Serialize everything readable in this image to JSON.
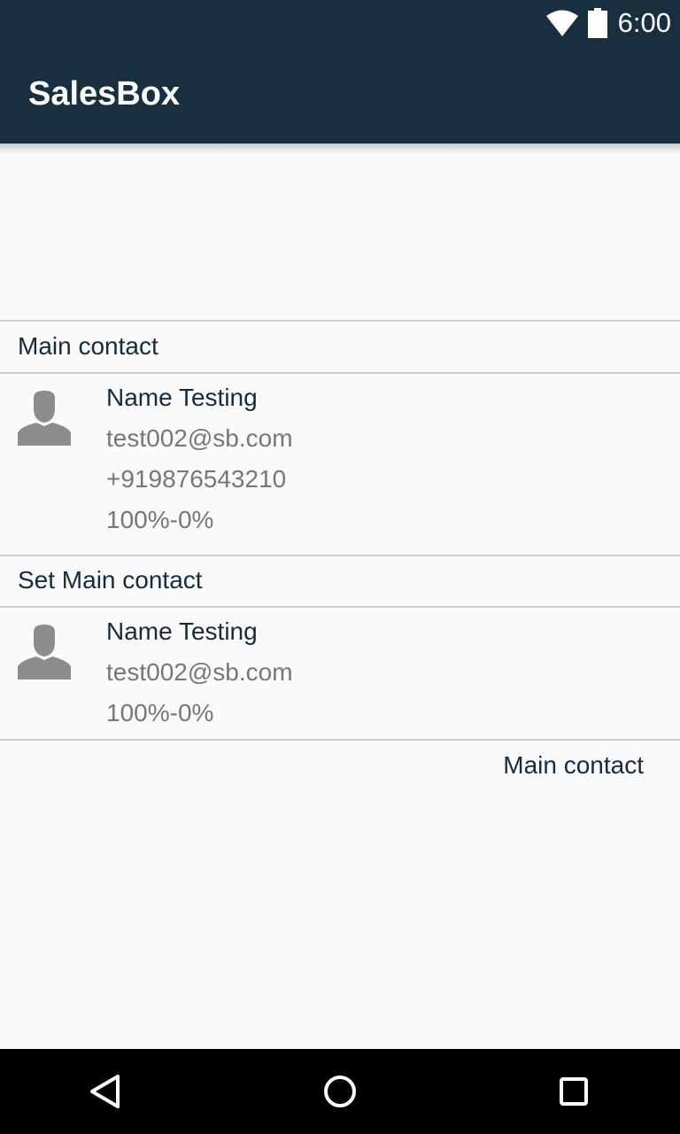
{
  "status_bar": {
    "time": "6:00",
    "icons": [
      "wifi-icon",
      "battery-icon"
    ]
  },
  "app_bar": {
    "title": "SalesBox"
  },
  "main_contact_section": {
    "title": "Main contact",
    "contact": {
      "avatar_icon": "person-icon",
      "name": "Name Testing",
      "email": "test002@sb.com",
      "phone": "+919876543210",
      "percentage": "100%-0%"
    }
  },
  "set_main_contact_section": {
    "title": "Set Main contact",
    "contact": {
      "avatar_icon": "person-icon",
      "name": "Name Testing",
      "email": "test002@sb.com",
      "percentage": "100%-0%"
    },
    "action_label": "Main contact"
  },
  "nav_bar": {
    "icons": [
      "back-icon",
      "home-icon",
      "recents-icon"
    ]
  },
  "colors": {
    "app_bar": "#182f3f",
    "primary_text": "#172b3a",
    "secondary_text": "#777777",
    "background": "#fafafa",
    "divider": "#cfcfcf"
  }
}
